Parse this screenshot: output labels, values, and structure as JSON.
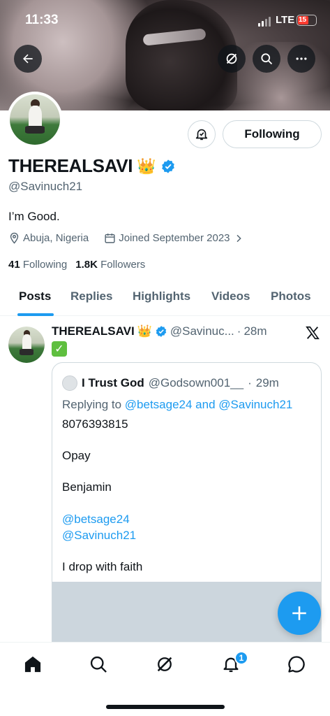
{
  "status_bar": {
    "time": "11:33",
    "network": "LTE",
    "battery": "15"
  },
  "header_icons": {
    "back": "back-arrow-icon",
    "grok": "grok-icon",
    "search": "search-icon",
    "more": "more-icon"
  },
  "profile": {
    "display_name": "THEREALSAVI",
    "crown": "👑",
    "handle": "@Savinuch21",
    "bio": "I’m Good.",
    "location": "Abuja, Nigeria",
    "joined": "Joined September 2023",
    "following_count": "41",
    "following_label": "Following",
    "followers_count": "1.8K",
    "followers_label": "Followers",
    "follow_button": "Following"
  },
  "tabs": [
    "Posts",
    "Replies",
    "Highlights",
    "Videos",
    "Photos"
  ],
  "post": {
    "author_name": "THEREALSAVI",
    "crown": "👑",
    "author_handle": "@Savinuc...",
    "sep": "·",
    "time": "28m",
    "emoji": "✅",
    "quote": {
      "author_name": "I Trust God",
      "author_handle": "@Godsown001__",
      "sep": "·",
      "time": "29m",
      "replying_prefix": "Replying to ",
      "replying_user1": "@betsage24",
      "replying_and": " and ",
      "replying_user2": "@Savinuch21",
      "line1": "8076393815",
      "line2": "Opay",
      "line3": "Benjamin",
      "mention1": "@betsage24",
      "mention2": "@Savinuch21",
      "line4": "I drop with faith"
    }
  },
  "bottom_nav": {
    "notifications_badge": "1"
  },
  "colors": {
    "accent": "#1d9bf0",
    "text": "#0f1419",
    "muted": "#536471"
  }
}
